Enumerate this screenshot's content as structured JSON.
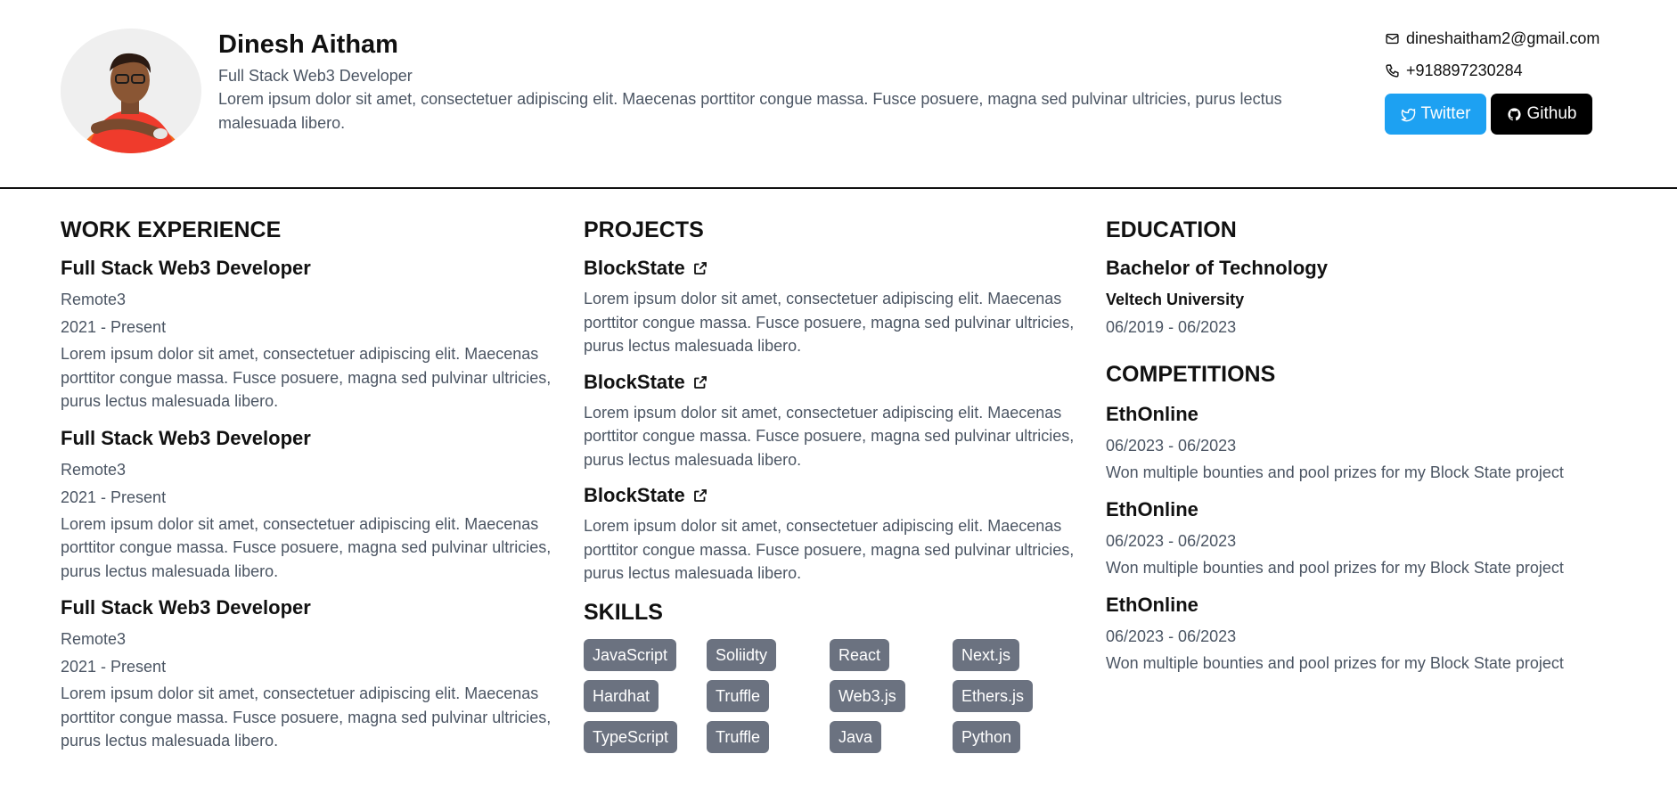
{
  "profile": {
    "name": "Dinesh Aitham",
    "role": "Full Stack Web3 Developer",
    "bio": "Lorem ipsum dolor sit amet, consectetuer adipiscing elit. Maecenas porttitor congue massa. Fusce posuere, magna sed pulvinar ultricies, purus lectus malesuada libero.",
    "email": "dineshaitham2@gmail.com",
    "phone": "+918897230284",
    "social": [
      {
        "label": "Twitter",
        "icon": "twitter-icon",
        "color": "#1da1f2"
      },
      {
        "label": "Github",
        "icon": "github-icon",
        "color": "#000000"
      }
    ]
  },
  "work": {
    "title": "WORK EXPERIENCE",
    "items": [
      {
        "role": "Full Stack Web3 Developer",
        "company": "Remote3",
        "period": "2021 - Present",
        "desc": "Lorem ipsum dolor sit amet, consectetuer adipiscing elit. Maecenas porttitor congue massa. Fusce posuere, magna sed pulvinar ultricies, purus lectus malesuada libero."
      },
      {
        "role": "Full Stack Web3 Developer",
        "company": "Remote3",
        "period": "2021 - Present",
        "desc": "Lorem ipsum dolor sit amet, consectetuer adipiscing elit. Maecenas porttitor congue massa. Fusce posuere, magna sed pulvinar ultricies, purus lectus malesuada libero."
      },
      {
        "role": "Full Stack Web3 Developer",
        "company": "Remote3",
        "period": "2021 - Present",
        "desc": "Lorem ipsum dolor sit amet, consectetuer adipiscing elit. Maecenas porttitor congue massa. Fusce posuere, magna sed pulvinar ultricies, purus lectus malesuada libero."
      }
    ]
  },
  "projects": {
    "title": "PROJECTS",
    "items": [
      {
        "name": "BlockState",
        "desc": "Lorem ipsum dolor sit amet, consectetuer adipiscing elit. Maecenas porttitor congue massa. Fusce posuere, magna sed pulvinar ultricies, purus lectus malesuada libero."
      },
      {
        "name": "BlockState",
        "desc": "Lorem ipsum dolor sit amet, consectetuer adipiscing elit. Maecenas porttitor congue massa. Fusce posuere, magna sed pulvinar ultricies, purus lectus malesuada libero."
      },
      {
        "name": "BlockState",
        "desc": "Lorem ipsum dolor sit amet, consectetuer adipiscing elit. Maecenas porttitor congue massa. Fusce posuere, magna sed pulvinar ultricies, purus lectus malesuada libero."
      }
    ]
  },
  "skills": {
    "title": "SKILLS",
    "items": [
      "JavaScript",
      "Soliidty",
      "React",
      "Next.js",
      "Hardhat",
      "Truffle",
      "Web3.js",
      "Ethers.js",
      "TypeScript",
      "Truffle",
      "Java",
      "Python"
    ],
    "badge_color": "#6b7280"
  },
  "education": {
    "title": "EDUCATION",
    "degree": "Bachelor of Technology",
    "school": "Veltech University",
    "period": "06/2019 - 06/2023"
  },
  "competitions": {
    "title": "COMPETITIONS",
    "items": [
      {
        "name": "EthOnline",
        "period": "06/2023 - 06/2023",
        "desc": "Won multiple bounties and pool prizes for my Block State project"
      },
      {
        "name": "EthOnline",
        "period": "06/2023 - 06/2023",
        "desc": "Won multiple bounties and pool prizes for my Block State project"
      },
      {
        "name": "EthOnline",
        "period": "06/2023 - 06/2023",
        "desc": "Won multiple bounties and pool prizes for my Block State project"
      }
    ]
  }
}
